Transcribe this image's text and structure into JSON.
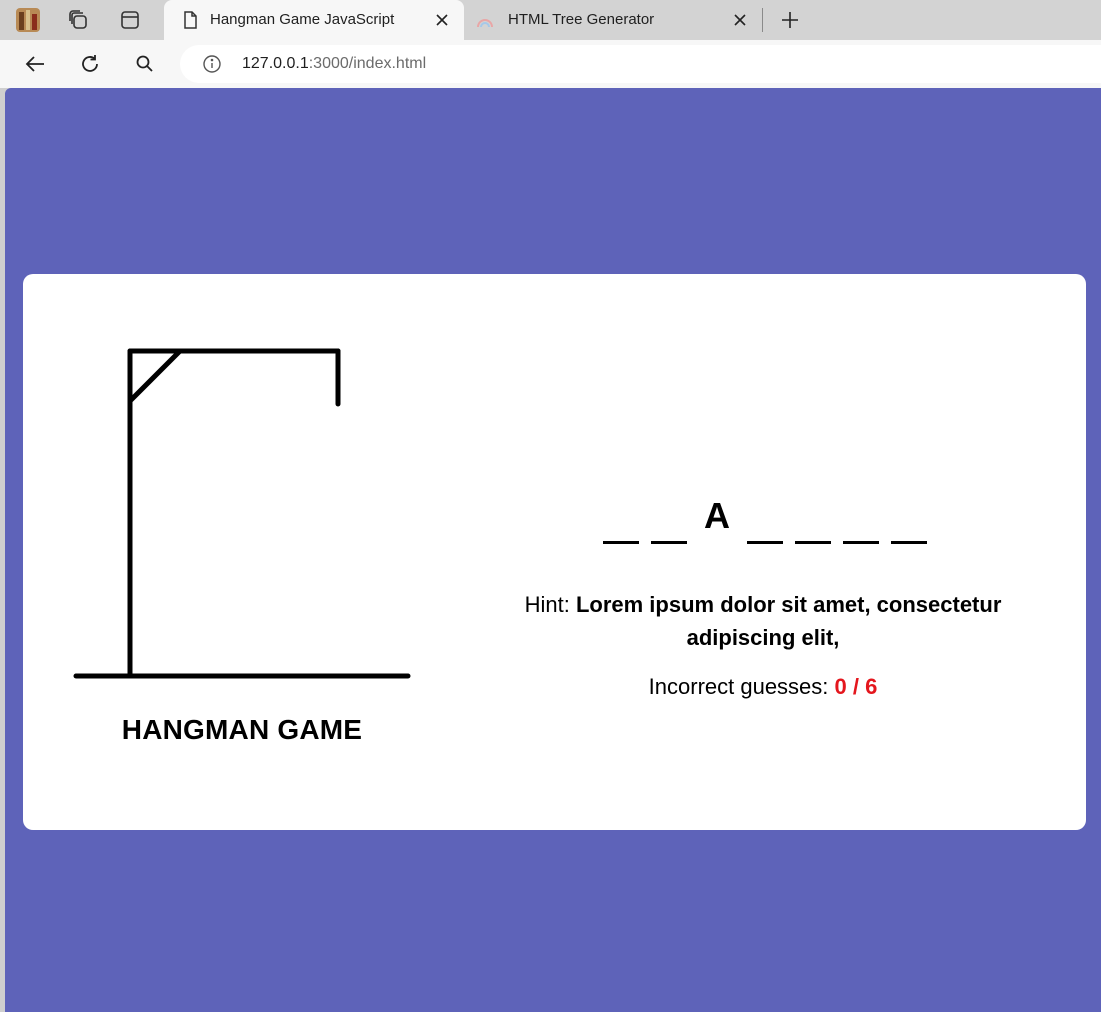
{
  "browser": {
    "tabs": [
      {
        "title": "Hangman Game JavaScript",
        "active": true,
        "icon": "page-icon"
      },
      {
        "title": "HTML Tree Generator",
        "active": false,
        "icon": "rainbow-favicon-icon"
      }
    ],
    "address": {
      "host": "127.0.0.1",
      "rest": ":3000/index.html"
    }
  },
  "game": {
    "title": "HANGMAN GAME",
    "word_letters": [
      "",
      "",
      "A",
      "",
      "",
      "",
      ""
    ],
    "hint_label": "Hint: ",
    "hint_text": "Lorem ipsum dolor sit amet, consectetur adipiscing elit,",
    "guesses_label": "Incorrect guesses: ",
    "guesses_text": "0 / 6",
    "incorrect_guesses": 0,
    "max_guesses": 6
  },
  "colors": {
    "page_background": "#5e63b9",
    "card_background": "#ffffff",
    "guess_count": "#e4161d"
  }
}
